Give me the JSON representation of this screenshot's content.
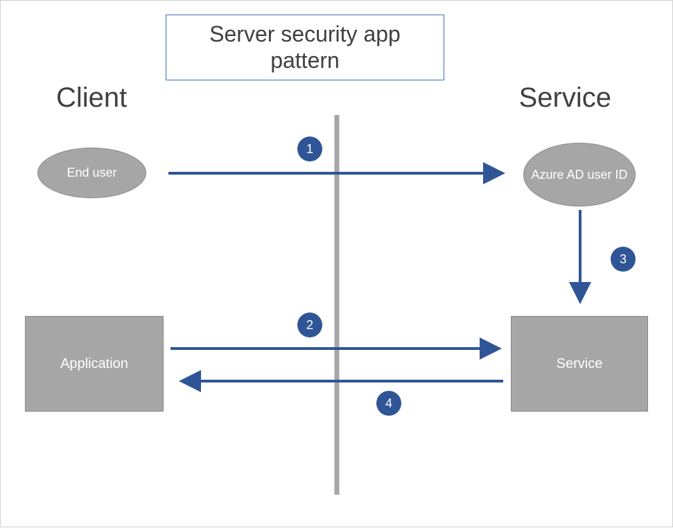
{
  "diagram": {
    "title": "Server security app pattern",
    "sections": {
      "client": "Client",
      "service": "Service"
    },
    "nodes": {
      "end_user": "End user",
      "azure_ad_user_id": "Azure AD user ID",
      "application": "Application",
      "service": "Service"
    },
    "steps": {
      "step1": {
        "label": "1",
        "from": "end_user",
        "to": "azure_ad_user_id"
      },
      "step2": {
        "label": "2",
        "from": "application",
        "to": "service"
      },
      "step3": {
        "label": "3",
        "from": "azure_ad_user_id",
        "to": "service"
      },
      "step4": {
        "label": "4",
        "from": "service",
        "to": "application"
      }
    },
    "colors": {
      "arrow": "#2f5597",
      "node_fill": "#a6a6a6",
      "node_stroke": "#888888",
      "divider": "#a6a6a6",
      "title_border": "#3f6fb5",
      "step_fill": "#2f5597"
    }
  }
}
